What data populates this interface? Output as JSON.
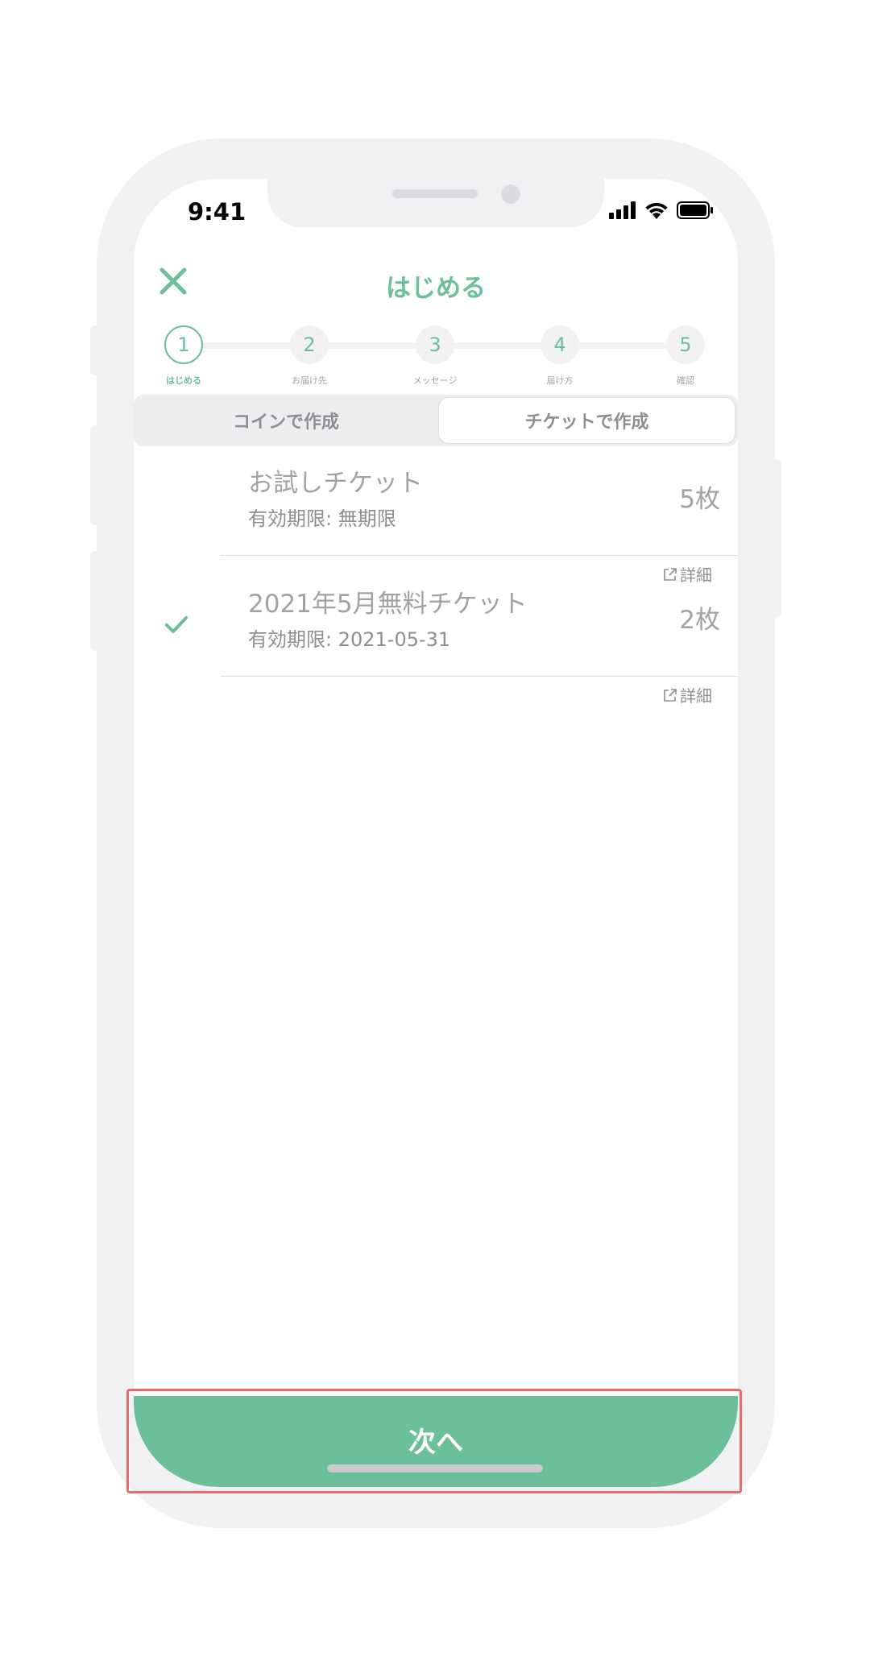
{
  "status_bar": {
    "time": "9:41",
    "icons": [
      "signal-icon",
      "wifi-icon",
      "battery-icon"
    ]
  },
  "header": {
    "title": "はじめる",
    "close_icon": "close-icon"
  },
  "stepper": {
    "steps": [
      {
        "number": "1",
        "label": "はじめる",
        "active": true
      },
      {
        "number": "2",
        "label": "お届け先",
        "active": false
      },
      {
        "number": "3",
        "label": "メッセージ",
        "active": false
      },
      {
        "number": "4",
        "label": "届け方",
        "active": false
      },
      {
        "number": "5",
        "label": "確認",
        "active": false
      }
    ]
  },
  "segmented": {
    "options": [
      "コインで作成",
      "チケットで作成"
    ],
    "selected": "チケットで作成"
  },
  "tickets": [
    {
      "title": "お試しチケット",
      "validity": "有効期限: 無期限",
      "count": "5枚",
      "detail": "詳細",
      "selected": false
    },
    {
      "title": "2021年5月無料チケット",
      "validity": "有効期限: 2021-05-31",
      "count": "2枚",
      "detail": "詳細",
      "selected": true
    }
  ],
  "next_button": {
    "label": "次へ"
  },
  "colors": {
    "accent": "#6bc09a",
    "highlight": "#e86c6c",
    "device": "#f1f1f3"
  }
}
